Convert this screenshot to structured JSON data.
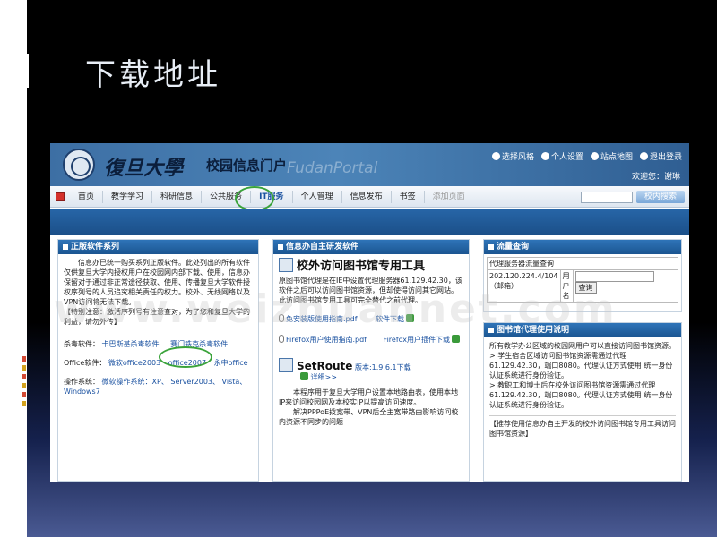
{
  "slide": {
    "title": "下载地址",
    "watermark": "www.weizhuannet.com"
  },
  "portal": {
    "university_name": "復旦大學",
    "portal_name": "校园信息门户",
    "portal_watermark": "FudanPortal",
    "top_links": [
      "选择风格",
      "个人设置",
      "站点地图",
      "退出登录"
    ],
    "welcome": "欢迎您：谢琳",
    "nav": [
      "首页",
      "教学学习",
      "科研信息",
      "公共服务",
      "IT服务",
      "个人管理",
      "信息发布",
      "书签",
      "添加页面"
    ],
    "search_button": "校内搜索"
  },
  "left_panel": {
    "title": "正版软件系列",
    "intro": "信息办已统一购买系列正版软件。此处列出的所有软件仅供复旦大学内授权用户在校园网内部下载、使用，信息办保留对于通过非正常途径获取、使用、传播复旦大学软件授权序列号的人员追究相关责任的权力。校外、无线网络以及VPN访问将无法下载。",
    "notice": "【特别注意：激活序列号有注意查对，为了您和复旦大学的利益，请勿外传】",
    "antivirus_label": "杀毒软件：",
    "antivirus_items": [
      "卡巴斯基杀毒软件",
      "赛门铁克杀毒软件"
    ],
    "office_label": "Office软件：",
    "office_items": [
      "微软office2003",
      "office2007",
      "永中office"
    ],
    "os_label": "操作系统：",
    "os_items": [
      "微软操作系统：XP、",
      "Server2003、",
      "Vista、",
      "Windows7"
    ]
  },
  "middle_panel": {
    "title": "信息办自主研发软件",
    "headline": "校外访问图书馆专用工具",
    "description": "原图书馆代理是在IE中设置代理服务器61.129.42.30，该软件之后可以访问图书馆资源，但却使得访问其它网站。此访问图书馆专用工具可完全替代之前代理。",
    "links": [
      {
        "name": "免安装版使用指南.pdf",
        "action": "软件下载"
      },
      {
        "name": "Firefox用户使用指南.pdf",
        "action": "Firefox用户插件下载"
      }
    ],
    "setroute_title": "SetRoute",
    "setroute_version": "版本:1.9.6.1下载",
    "setroute_detail": "详细>>",
    "setroute_desc_1": "本程序用于复旦大学用户设置本地路由表，使用本地IP来访问校园网及本校实IP以提高访问速度。",
    "setroute_desc_2": "解决PPPoE拨宽带、VPN后全主宽带路由影响访问校内资源不同步的问题"
  },
  "right_panel": {
    "traffic_title": "流量查询",
    "traffic_table_header": "代理服务器流量查询",
    "traffic_ip": "202.120.224.4/104（邮箱）",
    "traffic_user_label": "用户名",
    "query_button": "查询",
    "proxy_title": "图书馆代理使用说明",
    "proxy_intro": "所有教学办公区域的校园网用户可以直接访问图书馆资源。",
    "proxy_students": "> 学生宿舍区域访问图书馆资源需通过代理61.129.42.30，端口8080。代理认证方式使用 统一身份认证系统进行身份验证。",
    "proxy_staff": "> 教职工和博士后在校外访问图书馆资源需通过代理61.129.42.30，端口8080。代理认证方式使用 统一身份认证系统进行身份验证。",
    "recommend": "【推荐使用信息办自主开发的校外访问图书馆专用工具访问图书馆资源】"
  }
}
